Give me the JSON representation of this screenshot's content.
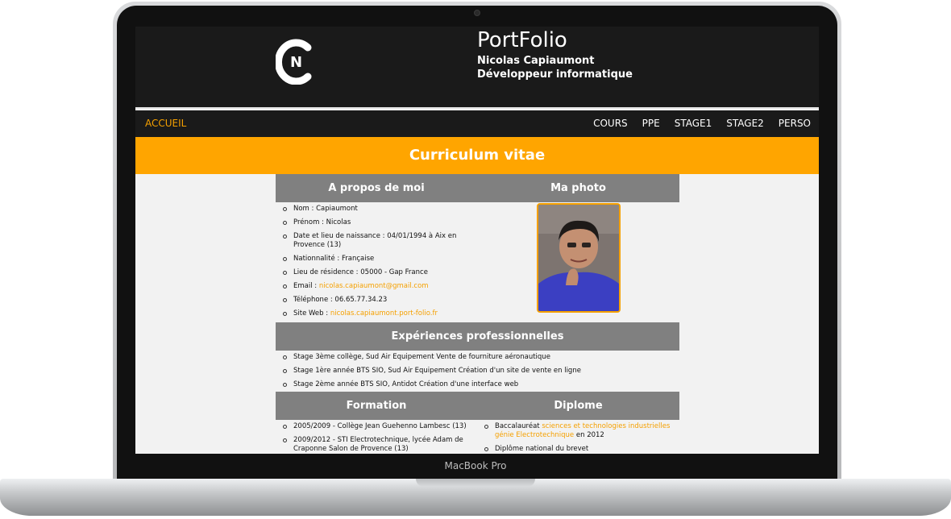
{
  "laptop": {
    "bezel_label": "MacBook Pro"
  },
  "header": {
    "logo_icon": "cn-monogram-logo",
    "title": "PortFolio",
    "name": "Nicolas Capiaumont",
    "job": "Développeur informatique"
  },
  "nav": {
    "home": "ACCUEIL",
    "items": [
      "COURS",
      "PPE",
      "STAGE1",
      "STAGE2",
      "PERSO"
    ]
  },
  "banner": {
    "title": "Curriculum vitae"
  },
  "about": {
    "heading": "A propos de moi",
    "items": [
      {
        "label": "Nom : Capiaumont"
      },
      {
        "label": "Prénom : Nicolas"
      },
      {
        "label": "Date et lieu de naissance : 04/01/1994 à Aix en Provence (13)"
      },
      {
        "label": "Nationnalité : Française"
      },
      {
        "label": "Lieu de résidence : 05000 - Gap France"
      },
      {
        "label": "Email : ",
        "link": "nicolas.capiaumont@gmail.com"
      },
      {
        "label": "Téléphone : 06.65.77.34.23"
      },
      {
        "label": "Site Web : ",
        "link": "nicolas.capiaumont.port-folio.fr"
      }
    ]
  },
  "photo": {
    "heading": "Ma photo"
  },
  "experience": {
    "heading": "Expériences professionnelles",
    "items": [
      "Stage 3ème collège, Sud Air Equipement Vente de fourniture aéronautique",
      "Stage 1ère année BTS SIO, Sud Air Equipement Création d'un site de vente en ligne",
      "Stage 2ème année BTS SIO, Antidot Création d'une interface web"
    ]
  },
  "formation": {
    "heading": "Formation",
    "items": [
      "2005/2009 - Collège Jean Guehenno Lambesc (13)",
      "2009/2012 - STI Electrotechnique, lycée Adam de Craponne Salon de Provence (13)"
    ]
  },
  "diplome": {
    "heading": "Diplome",
    "items": [
      {
        "before": "Baccalauréat ",
        "link": "sciences et technologies industrielles génie Electrotechnique",
        "after": " en 2012"
      },
      {
        "before": "Diplôme national du brevet"
      }
    ]
  },
  "colors": {
    "accent": "#ffa500",
    "header_bg": "#1a1a1a",
    "section_bg": "#808080",
    "page_bg": "#f2f2f2"
  }
}
